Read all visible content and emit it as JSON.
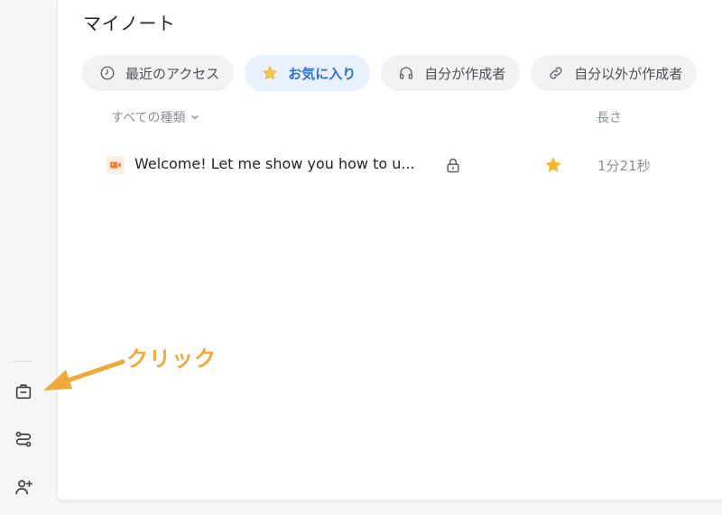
{
  "page": {
    "title": "マイノート"
  },
  "tabs": [
    {
      "label": "最近のアクセス",
      "icon": "clock-icon",
      "active": false
    },
    {
      "label": "お気に入り",
      "icon": "star-icon",
      "active": true
    },
    {
      "label": "自分が作成者",
      "icon": "headphones-icon",
      "active": false
    },
    {
      "label": "自分以外が作成者",
      "icon": "link-icon",
      "active": false
    }
  ],
  "list": {
    "type_filter_label": "すべての種類",
    "length_header": "長さ",
    "rows": [
      {
        "title": "Welcome! Let me show you how to u...",
        "type_icon": "video-icon",
        "locked": true,
        "starred": true,
        "length": "1分21秒"
      }
    ]
  },
  "sidebar": {
    "items": [
      {
        "icon": "briefcase-icon"
      },
      {
        "icon": "route-icon"
      },
      {
        "icon": "add-user-icon"
      }
    ]
  },
  "annotation": {
    "text": "クリック"
  },
  "colors": {
    "accent_blue": "#2f6fd6",
    "active_tab_bg": "#e8f1fd",
    "star": "#f5b731",
    "video_icon": "#ef7d32",
    "annotation": "#f2a93b"
  }
}
